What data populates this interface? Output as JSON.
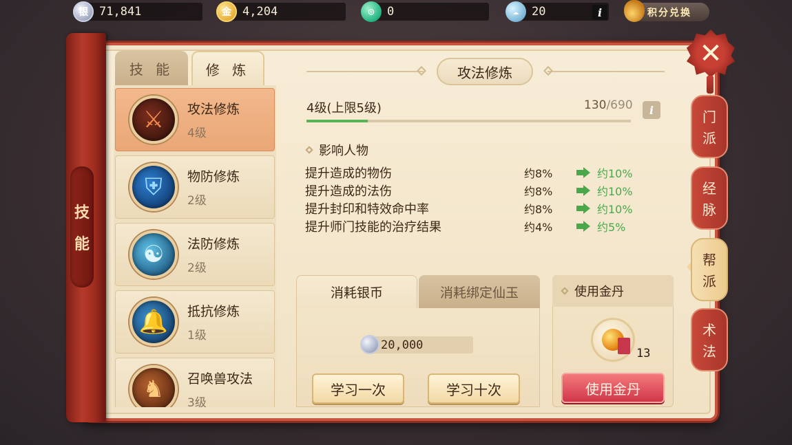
{
  "currencies": [
    {
      "icon": "silver-coin-icon",
      "value": "71,841"
    },
    {
      "icon": "gold-coin-icon",
      "value": "4,204"
    },
    {
      "icon": "jade-icon",
      "value": "0"
    },
    {
      "icon": "cloud-token-icon",
      "value": "20"
    }
  ],
  "top": {
    "info_label": "i",
    "exchange_label": "积分兑换"
  },
  "side_spine_label": [
    "技",
    "能"
  ],
  "left_tabs": [
    {
      "label": "技 能",
      "active": false
    },
    {
      "label": "修 炼",
      "active": true
    }
  ],
  "skills": [
    {
      "name": "攻法修炼",
      "level": "4级",
      "icon": "sword-icon",
      "selected": true
    },
    {
      "name": "物防修炼",
      "level": "2级",
      "icon": "shield-icon",
      "selected": false
    },
    {
      "name": "法防修炼",
      "level": "2级",
      "icon": "orb-icon",
      "selected": false
    },
    {
      "name": "抵抗修炼",
      "level": "1级",
      "icon": "bell-icon",
      "selected": false
    },
    {
      "name": "召唤兽攻法",
      "level": "3级",
      "icon": "beast-icon",
      "selected": false
    }
  ],
  "detail": {
    "title": "攻法修炼",
    "level_text": "4级(上限5级)",
    "exp_current": "130",
    "exp_max": "/690",
    "exp_fraction": 0.1884,
    "info_label": "i",
    "affect_heading": "影响人物",
    "effects": [
      {
        "desc": "提升造成的物伤",
        "current": "约8%",
        "next": "约10%"
      },
      {
        "desc": "提升造成的法伤",
        "current": "约8%",
        "next": "约10%"
      },
      {
        "desc": "提升封印和特效命中率",
        "current": "约8%",
        "next": "约10%"
      },
      {
        "desc": "提升师门技能的治疗结果",
        "current": "约4%",
        "next": "约5%"
      }
    ]
  },
  "cost": {
    "tabs": [
      {
        "label": "消耗银币",
        "active": true
      },
      {
        "label": "消耗绑定仙玉",
        "active": false
      }
    ],
    "amount": "20,000",
    "study_once": "学习一次",
    "study_ten": "学习十次"
  },
  "pill": {
    "heading": "使用金丹",
    "count": "13",
    "button": "使用金丹"
  },
  "right_tabs": [
    {
      "label": [
        "门",
        "派"
      ],
      "active": false
    },
    {
      "label": [
        "经",
        "脉"
      ],
      "active": false
    },
    {
      "label": [
        "帮",
        "派"
      ],
      "active": true
    },
    {
      "label": [
        "术",
        "法"
      ],
      "active": false
    }
  ],
  "close_label": "✕"
}
